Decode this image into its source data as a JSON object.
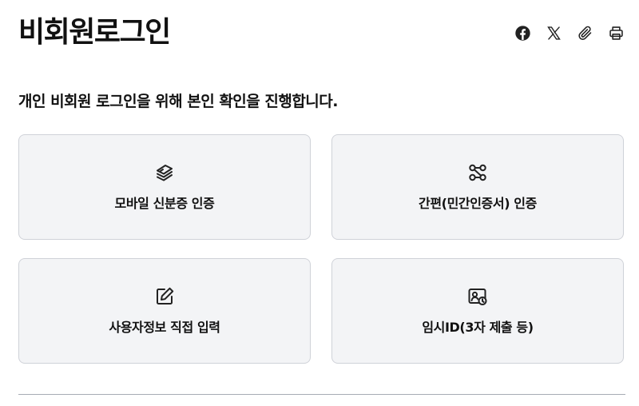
{
  "header": {
    "title": "비회원로그인",
    "share_icons": [
      "facebook-icon",
      "x-icon",
      "link-icon",
      "print-icon"
    ]
  },
  "intro": {
    "text": "개인 비회원 로그인을 위해 본인 확인을 진행합니다."
  },
  "options": [
    {
      "label": "모바일 신분증 인증",
      "icon": "mobile-id-icon"
    },
    {
      "label": "간편(민간인증서) 인증",
      "icon": "simple-cert-icon"
    },
    {
      "label": "사용자정보 직접 입력",
      "icon": "edit-icon"
    },
    {
      "label": "임시ID(3자 제출 등)",
      "icon": "temporary-id-icon"
    }
  ],
  "colors": {
    "card_background": "#f3f4f6",
    "card_border": "#cfd2d8",
    "divider": "#a7abb4",
    "text": "#111111"
  }
}
